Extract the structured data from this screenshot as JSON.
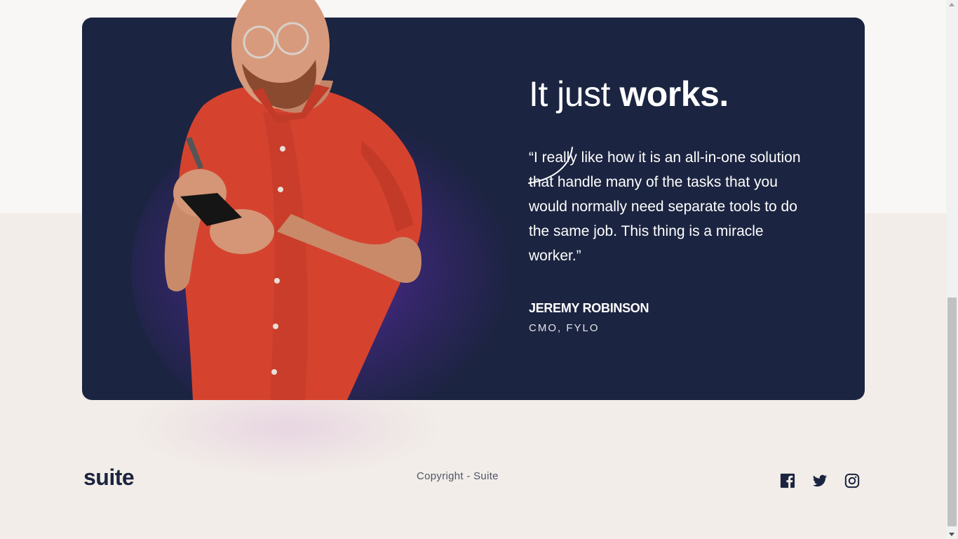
{
  "testimonial": {
    "headline_light": "It just ",
    "headline_bold": "works.",
    "quote": "“I really like how it is an all-in-one solution that handle many of the tasks that you would normally need separate tools to do the same job. This thing is a miracle worker.”",
    "author_name": "JEREMY ROBINSON",
    "author_role": "CMO, FYLO"
  },
  "footer": {
    "logo": "suite",
    "copyright": "Copyright - Suite",
    "social_icons": [
      "facebook-icon",
      "twitter-icon",
      "instagram-icon"
    ]
  },
  "colors": {
    "card_bg": "#1b2440",
    "page_bg_top": "#f8f7f5",
    "page_bg_bottom": "#f2ede8",
    "shirt": "#d8432f",
    "accent_glow": "#7832be",
    "text_dark": "#1b2440"
  }
}
